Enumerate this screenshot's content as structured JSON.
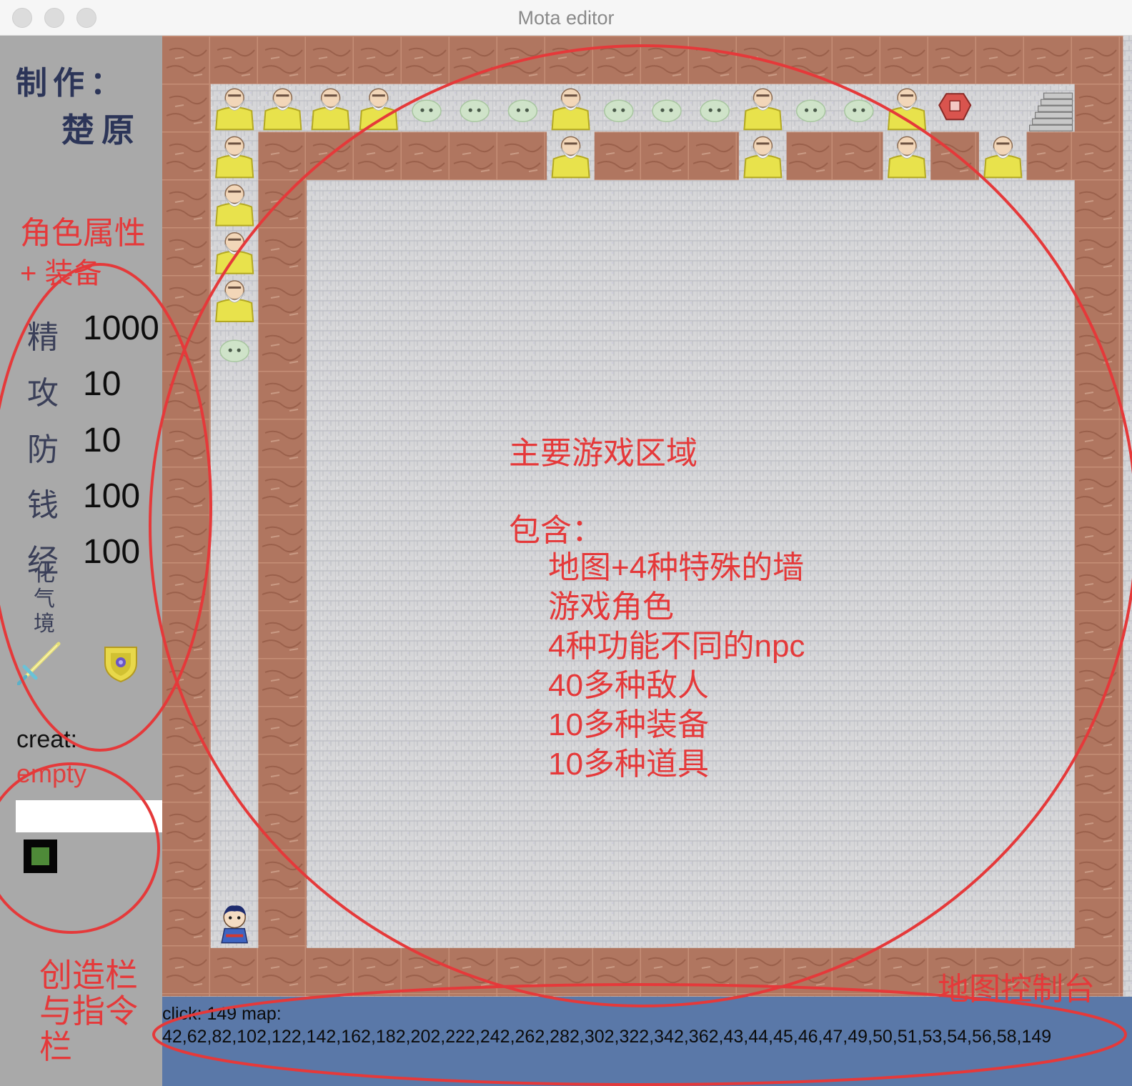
{
  "window": {
    "title": "Mota editor"
  },
  "sidebar": {
    "credit_line1": "制作：",
    "credit_line2": "楚原",
    "stats": [
      {
        "label": "精",
        "value": "1000"
      },
      {
        "label": "攻",
        "value": "10"
      },
      {
        "label": "防",
        "value": "10"
      },
      {
        "label": "钱",
        "value": "100"
      },
      {
        "label": "经",
        "value": "100"
      }
    ],
    "realm": "化气境",
    "equipment": [
      "sword-icon",
      "shield-icon"
    ],
    "creat_label": "creat:",
    "creat_value": "empty",
    "command_input_value": ""
  },
  "console": {
    "line1": "click: 149 map:",
    "line2": "42,62,82,102,122,142,162,182,202,222,242,262,282,302,322,342,362,43,44,45,46,47,49,50,51,53,54,56,58,149"
  },
  "annotations": {
    "main_title": "主要游戏区域",
    "contains": "包含：",
    "items": [
      "地图+4种特殊的墙",
      "游戏角色",
      "4种功能不同的npc",
      "40多种敌人",
      "10多种装备",
      "10多种道具"
    ],
    "attr_line1": "角色属性",
    "attr_line2": "+ 装备",
    "create_bar": "创造栏与指令栏",
    "map_console": "地图控制台"
  },
  "colors": {
    "sidebar_bg": "#a9a9a9",
    "console_bg": "#5a78a8",
    "wall": "#b07660",
    "floor": "#d6d6d8",
    "annotation": "#e5393a",
    "creat_value": "#e0403f",
    "toggle_fill": "#4e8a38"
  },
  "map_entities": {
    "npc": "old-man-npc-icon",
    "enemy": "green-slime-icon",
    "hero": "hero-icon",
    "stairs": "stairs-icon",
    "gem": "red-gem-icon"
  }
}
